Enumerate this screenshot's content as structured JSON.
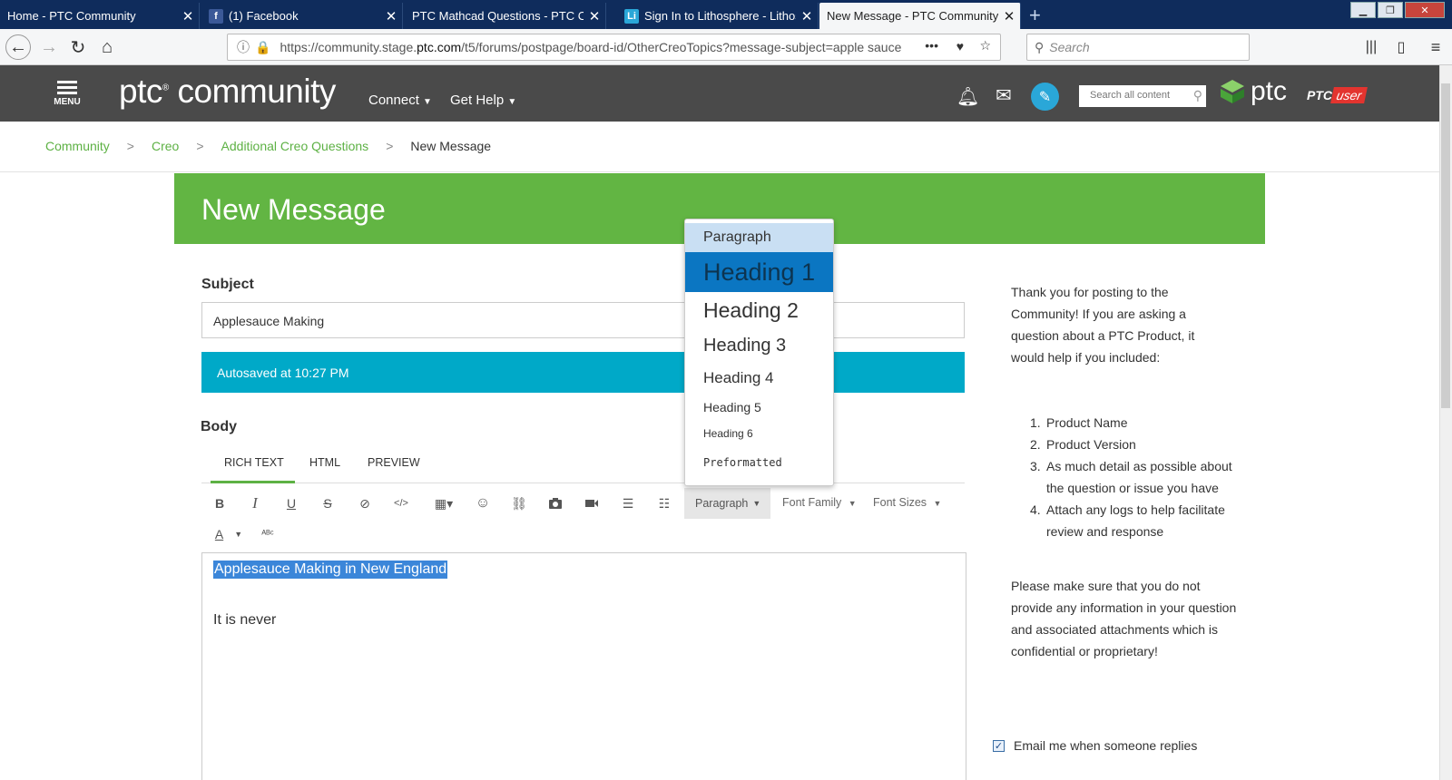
{
  "browser": {
    "tabs": [
      {
        "label": "Home - PTC Community",
        "favicon": ""
      },
      {
        "label": "(1) Facebook",
        "favicon": "f"
      },
      {
        "label": "PTC Mathcad Questions - PTC Com",
        "favicon": ""
      },
      {
        "label": "Sign In to Lithosphere - Lithosp",
        "favicon": "Li"
      },
      {
        "label": "New Message - PTC Community - ",
        "favicon": ""
      }
    ],
    "new_tab": "+",
    "url_prefix": "https://community.stage.",
    "url_host": "ptc.com",
    "url_path": "/t5/forums/postpage/board-id/OtherCreoTopics?message-subject=apple sauce",
    "url_more": "•••",
    "search_placeholder": "Search"
  },
  "header": {
    "menu_label": "MENU",
    "logo_ptc": "ptc",
    "logo_community": " community",
    "nav": [
      {
        "label": "Connect"
      },
      {
        "label": "Get Help"
      }
    ],
    "search_placeholder": "Search all content",
    "brand": "ptc",
    "ptcuser_a": "PTC",
    "ptcuser_b": "user"
  },
  "breadcrumb": {
    "items": [
      "Community",
      "Creo",
      "Additional Creo Questions"
    ],
    "current": "New Message",
    "separator": ">"
  },
  "page": {
    "title": "New Message",
    "subject_label": "Subject",
    "subject_value": "Applesauce Making",
    "autosave": "Autosaved at 10:27 PM",
    "body_label": "Body"
  },
  "editor": {
    "tabs": [
      "RICH TEXT",
      "HTML",
      "PREVIEW"
    ],
    "paragraph_dd": "Paragraph",
    "font_family_dd": "Font Family",
    "font_sizes_dd": "Font Sizes",
    "selected_text": "Applesauce Making in New England",
    "body_line2": "It is never"
  },
  "format_menu": {
    "items": [
      "Paragraph",
      "Heading 1",
      "Heading 2",
      "Heading 3",
      "Heading 4",
      "Heading 5",
      "Heading 6",
      "Preformatted"
    ]
  },
  "sidebar": {
    "intro": "Thank you for posting to the Community!  If you are asking a question about a PTC Product, it would help if you included:",
    "list": [
      "Product Name",
      "Product Version",
      "As much detail as possible about the question or issue you have",
      "Attach any logs to help facilitate review and response"
    ],
    "warning": "Please make sure that you do not provide any information in your question and associated attachments which is confidential or proprietary!",
    "email_label": "Email me when someone replies"
  },
  "colors": {
    "green": "#62b543",
    "teal": "#00a9c8",
    "header_gray": "#4a4a4a",
    "highlight_blue": "#0b76c2"
  }
}
